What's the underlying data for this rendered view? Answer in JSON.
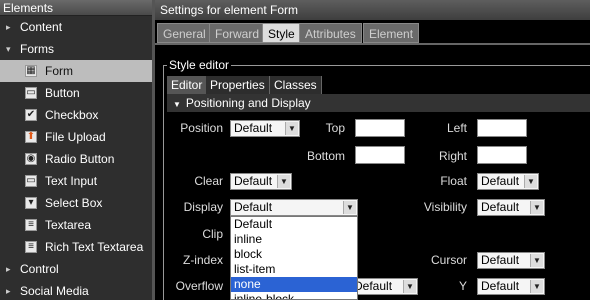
{
  "left_panel": {
    "title": "Elements",
    "groups": [
      {
        "label": "Content",
        "arrow": "▸"
      },
      {
        "label": "Forms",
        "arrow": "▾"
      },
      {
        "label": "Control",
        "arrow": "▸"
      },
      {
        "label": "Social Media",
        "arrow": "▸"
      }
    ],
    "form_items": [
      {
        "label": "Form",
        "icon": "form-icon",
        "glyph": "▦"
      },
      {
        "label": "Button",
        "icon": "button-icon",
        "glyph": "▭"
      },
      {
        "label": "Checkbox",
        "icon": "checkbox-icon",
        "glyph": "✔"
      },
      {
        "label": "File Upload",
        "icon": "file-upload-icon",
        "glyph": "⬆"
      },
      {
        "label": "Radio Button",
        "icon": "radio-button-icon",
        "glyph": "◉"
      },
      {
        "label": "Text Input",
        "icon": "text-input-icon",
        "glyph": "▭"
      },
      {
        "label": "Select Box",
        "icon": "select-box-icon",
        "glyph": "▾"
      },
      {
        "label": "Textarea",
        "icon": "textarea-icon",
        "glyph": "≡"
      },
      {
        "label": "Rich Text Textarea",
        "icon": "rich-text-textarea-icon",
        "glyph": "≡"
      }
    ]
  },
  "settings": {
    "title": "Settings for element Form",
    "tabs": [
      "General",
      "Forward",
      "Style",
      "Attributes",
      "Element"
    ],
    "active_tab": "Style"
  },
  "style_editor": {
    "legend": "Style editor",
    "tabs": [
      "Editor",
      "Properties",
      "Classes"
    ],
    "section": "Positioning and Display",
    "fields": {
      "position_label": "Position",
      "position_value": "Default",
      "top_label": "Top",
      "left_label": "Left",
      "bottom_label": "Bottom",
      "right_label": "Right",
      "clear_label": "Clear",
      "clear_value": "Default",
      "float_label": "Float",
      "float_value": "Default",
      "display_label": "Display",
      "display_value": "Default",
      "visibility_label": "Visibility",
      "visibility_value": "Default",
      "clip_label": "Clip",
      "zindex_label": "Z-index",
      "cursor_label": "Cursor",
      "cursor_value": "Default",
      "overflow_label": "Overflow",
      "overflow_value": "Default",
      "y_label": "Y",
      "y_value": "Default"
    },
    "display_options": [
      "Default",
      "inline",
      "block",
      "list-item",
      "none",
      "inline-block"
    ],
    "display_highlighted": "none"
  },
  "colors": {
    "highlight": "#2b63d4",
    "selected_tree_item": "#bdbdbd"
  }
}
